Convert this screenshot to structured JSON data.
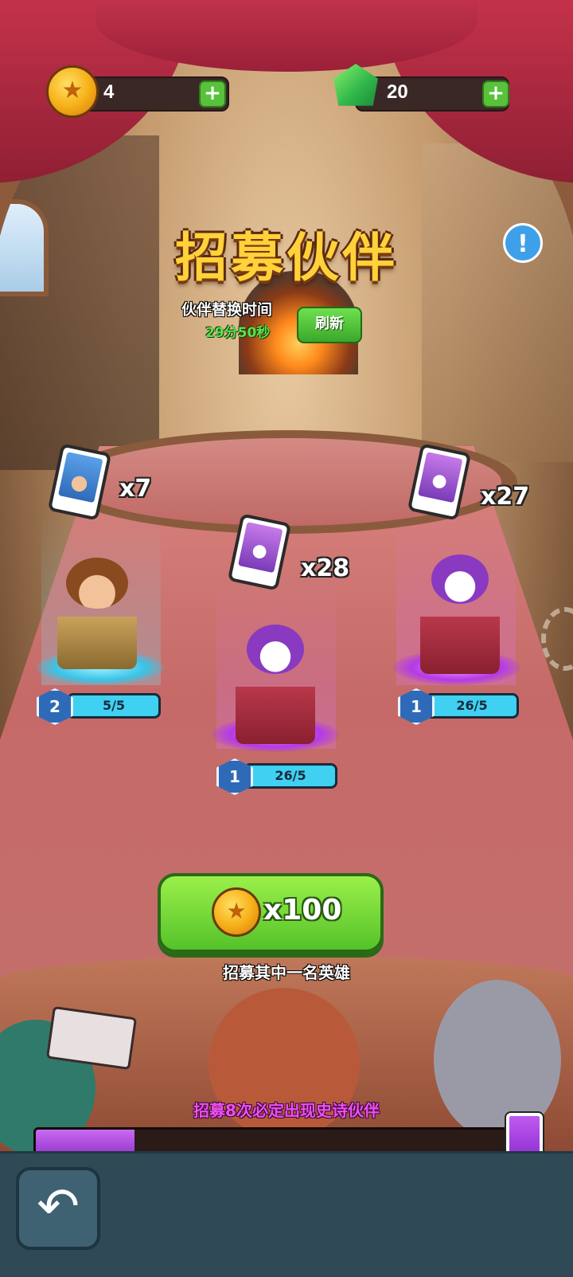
{
  "currency": {
    "coins": "4",
    "gems": "20",
    "add_symbol": "+"
  },
  "title": "招募伙伴",
  "info_symbol": "!",
  "timer": {
    "label": "伙伴替换时间",
    "value": "29分50秒",
    "refresh_label": "刷新"
  },
  "heroes": [
    {
      "type": "caveman",
      "card_count": "x7",
      "level": "2",
      "progress": "5/5",
      "rarity_color": "#3ac3e8"
    },
    {
      "type": "joker",
      "card_count": "x28",
      "level": "1",
      "progress": "26/5",
      "rarity_color": "#b43ae8"
    },
    {
      "type": "joker",
      "card_count": "x27",
      "level": "1",
      "progress": "26/5",
      "rarity_color": "#b43ae8"
    }
  ],
  "recruit": {
    "cost": "x100",
    "label": "招募其中一名英雄"
  },
  "pity": {
    "label": "招募8次必定出现史诗伙伴",
    "progress_fraction": 0.21
  },
  "icons": {
    "back": "back-arrow-icon",
    "coin": "coin-icon",
    "gem": "gem-icon"
  },
  "colors": {
    "accent_green": "#58c23a",
    "title_gold": "#ffd23a",
    "epic_purple": "#b43ae8"
  }
}
